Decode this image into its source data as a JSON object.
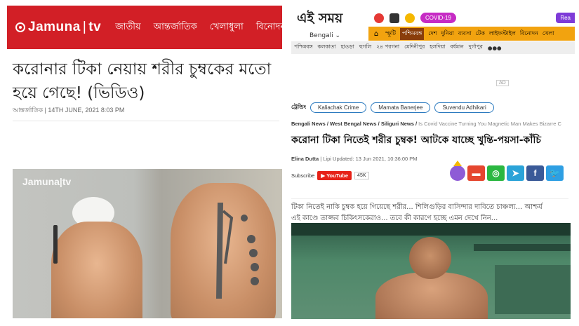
{
  "left": {
    "brand": "Jamuna",
    "brand_suffix": "tv",
    "nav": [
      "জাতীয়",
      "আন্তর্জাতিক",
      "খেলাধুলা",
      "বিনোদন"
    ],
    "headline": "করোনার টিকা নেয়ায় শরীর চুম্বকের মতো হয়ে গেছে! (ভিডিও)",
    "meta": "আন্তর্জাতিক | 14TH JUNE, 2021 8:03 PM",
    "image_watermark": "Jamuna|tv"
  },
  "right": {
    "logo": "এই সময়",
    "logo_sub": "Bengali ⌄",
    "covid_badge": "COVID-19",
    "read_badge": "Rea",
    "nav1": [
      "স্ফূটি",
      "পশ্চিমবঙ্গ",
      "দেশ",
      "দুনিয়া",
      "ব্যবসা",
      "টেক",
      "লাইফস্টাইল",
      "বিনোদন",
      "খেলা"
    ],
    "nav1_active": "পশ্চিমবঙ্গ",
    "nav2": [
      "পশ্চিমবঙ্গ",
      "কলকাতা",
      "হাওড়া",
      "হুগলি",
      "২৪ পরগনা",
      "মেদিনীপুর",
      "হলদিয়া",
      "বর্ধমান",
      "দুর্গাপুর",
      "●●●"
    ],
    "ad_label": "AD",
    "trending_label": "ট্রেন্ডিং",
    "trending": [
      "Kaliachak Crime",
      "Mamata Banerjee",
      "Suvendu Adhikari"
    ],
    "breadcrumb_bold": "Bengali News / West Bengal News / Siliguri News /",
    "breadcrumb_rest": " Is Covid Vaccine Turning You Magnetic Man Makes Bizarre C",
    "headline": "করোনা টিকা নিতেই শরীর চুম্বক! আটকে যাচ্ছে খুন্তি-পয়সা-কাঁচি",
    "author": "Elina Dutta",
    "byline_rest": " | Lipi  Updated: 13 Jun 2021, 10:36:00 PM",
    "subscribe_label": "Subscribe",
    "youtube_label": "YouTube",
    "youtube_count": "45K",
    "summary_line1": "টিকা নিতেই নাকি চুম্বক হয়ে গিয়েছে শরীর... শিলিগুড়ির বাসিন্দার দাবিতে চাঞ্চল্য... আশ্চর্য",
    "summary_line2": "এই কাণ্ডে তাজ্জব চিকিৎসকেরাও... তবে কী কারণে হচ্ছে এমন দেখে নিন...",
    "share_colors": {
      "comment": "#e5462f",
      "whatsapp": "#2bb741",
      "telegram": "#2aa3d8",
      "facebook": "#3a5a98",
      "twitter": "#2e9fe3"
    }
  }
}
